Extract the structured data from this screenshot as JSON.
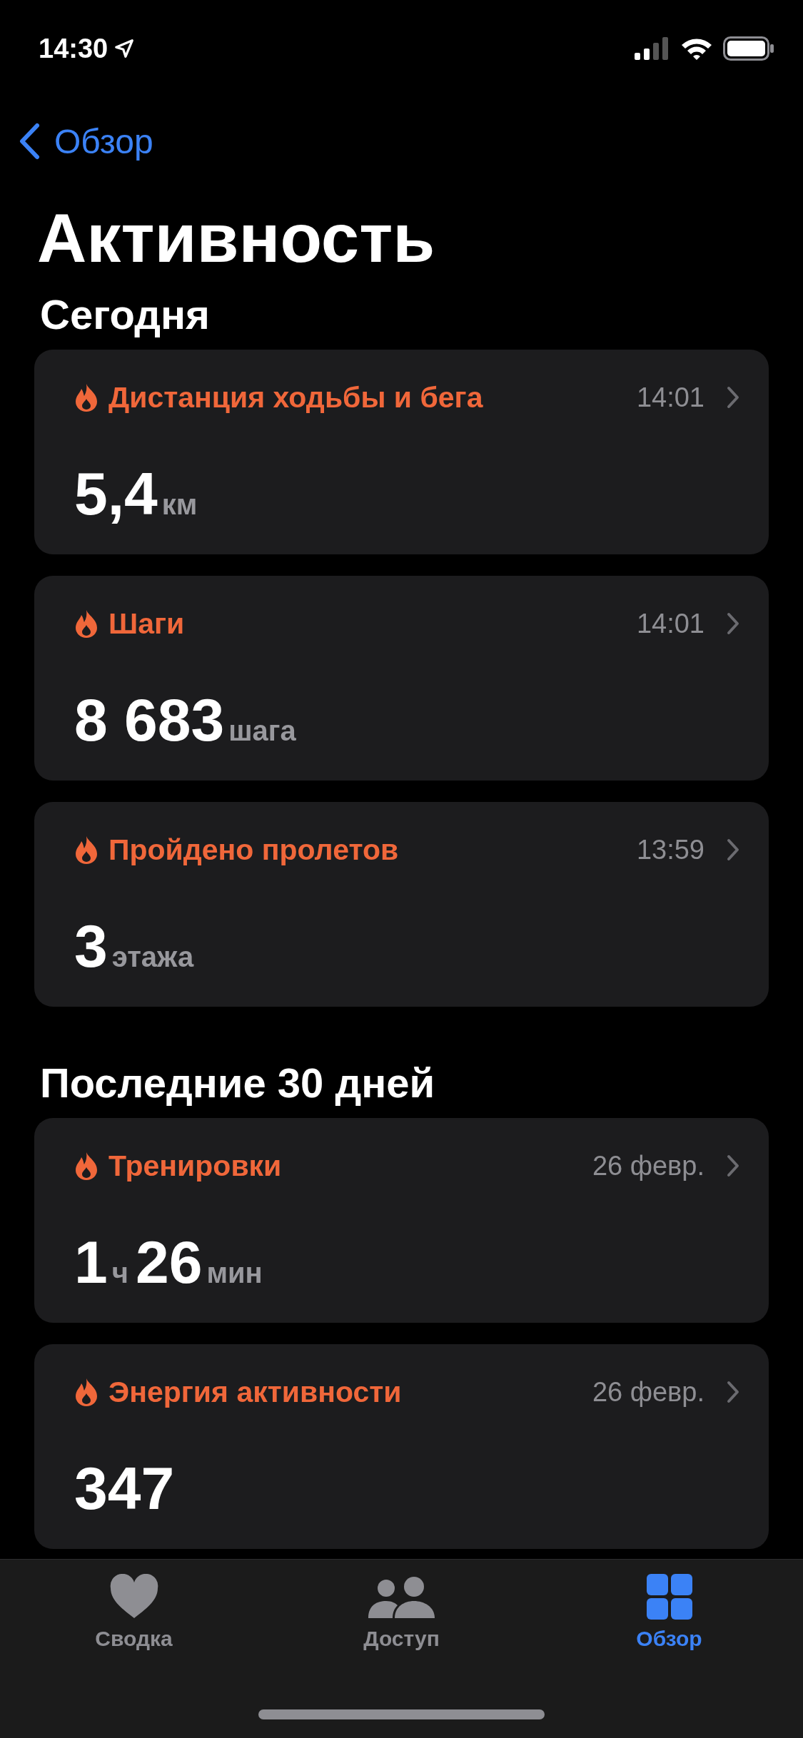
{
  "status_bar": {
    "time": "14:30"
  },
  "nav": {
    "back": "Обзор",
    "title": "Активность"
  },
  "sections": [
    {
      "title": "Сегодня",
      "cards": [
        {
          "title": "Дистанция ходьбы и бега",
          "time": "14:01",
          "value": [
            {
              "number": "5,4",
              "unit": "км"
            }
          ]
        },
        {
          "title": "Шаги",
          "time": "14:01",
          "value": [
            {
              "number": "8 683",
              "unit": "шага"
            }
          ]
        },
        {
          "title": "Пройдено пролетов",
          "time": "13:59",
          "value": [
            {
              "number": "3",
              "unit": "этажа"
            }
          ]
        }
      ]
    },
    {
      "title": "Последние 30 дней",
      "cards": [
        {
          "title": "Тренировки",
          "time": "26 февр.",
          "value": [
            {
              "number": "1",
              "unit": "ч"
            },
            {
              "number": "26",
              "unit": "мин"
            }
          ]
        },
        {
          "title": "Энергия активности",
          "time": "26 февр.",
          "value": [
            {
              "number": "347"
            }
          ]
        }
      ]
    }
  ],
  "tab_bar": [
    {
      "label": "Сводка",
      "kind": "heart",
      "selected": false
    },
    {
      "label": "Доступ",
      "kind": "people",
      "selected": false
    },
    {
      "label": "Обзор",
      "kind": "grid",
      "selected": true
    }
  ]
}
